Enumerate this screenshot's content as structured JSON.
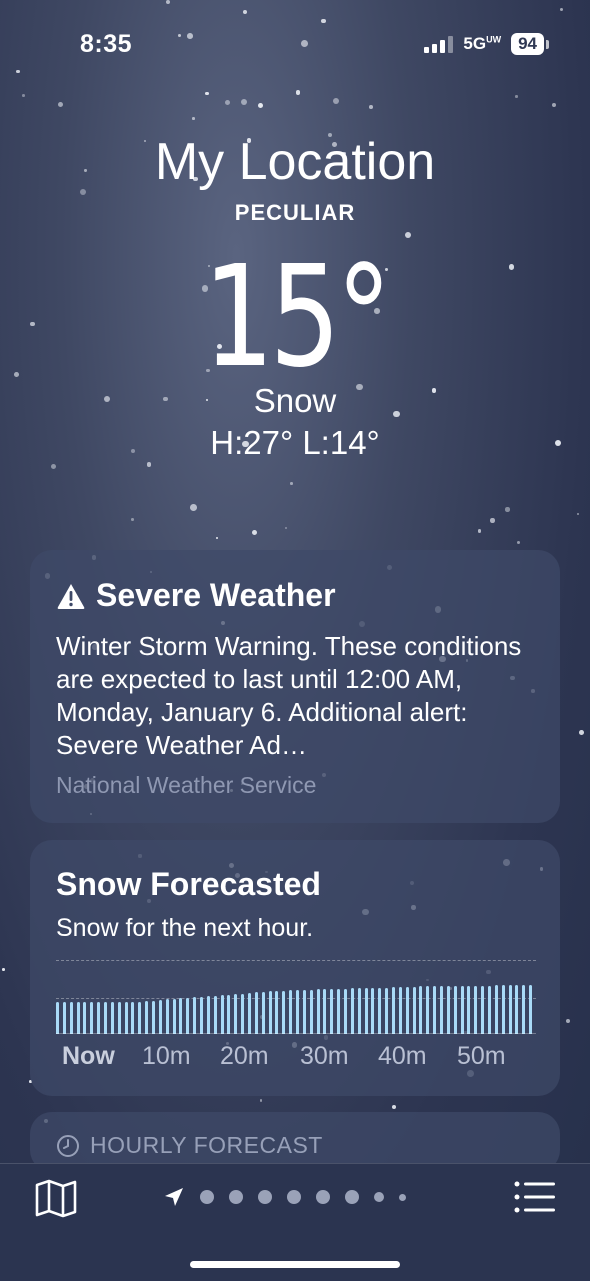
{
  "status_bar": {
    "time": "8:35",
    "network": "5G",
    "network_badge": "UW",
    "battery": "94"
  },
  "location": {
    "title": "My Location",
    "subtitle": "PECULIAR"
  },
  "current": {
    "temperature": "15°",
    "condition": "Snow",
    "high_low": "H:27°  L:14°"
  },
  "alert": {
    "title": "Severe Weather",
    "body": "Winter Storm Warning. These conditions are expected to last until 12:00 AM, Monday, January 6. Additional alert: Severe Weather Ad…",
    "source": "National Weather Service",
    "icon": "warning-triangle-icon"
  },
  "precip": {
    "title": "Snow Forecasted",
    "subtitle": "Snow for the next hour.",
    "ticks": [
      "Now",
      "10m",
      "20m",
      "30m",
      "40m",
      "50m"
    ],
    "intensity": [
      0.6,
      0.6,
      0.6,
      0.6,
      0.6,
      0.6,
      0.6,
      0.6,
      0.6,
      0.6,
      0.6,
      0.6,
      0.6,
      0.61,
      0.62,
      0.63,
      0.64,
      0.65,
      0.66,
      0.67,
      0.68,
      0.69,
      0.7,
      0.71,
      0.72,
      0.73,
      0.74,
      0.75,
      0.76,
      0.77,
      0.78,
      0.79,
      0.8,
      0.8,
      0.81,
      0.81,
      0.82,
      0.82,
      0.83,
      0.83,
      0.84,
      0.84,
      0.84,
      0.85,
      0.85,
      0.85,
      0.86,
      0.86,
      0.86,
      0.87,
      0.87,
      0.87,
      0.87,
      0.88,
      0.88,
      0.88,
      0.88,
      0.88,
      0.88,
      0.89,
      0.89,
      0.89,
      0.89,
      0.89,
      0.9,
      0.9,
      0.9,
      0.9,
      0.9,
      0.9
    ],
    "bar_color": "#a9daf7"
  },
  "hourly": {
    "label": "HOURLY FORECAST",
    "icon": "clock-icon"
  },
  "bottom_bar": {
    "map_icon": "map-icon",
    "list_icon": "list-icon",
    "location_icon": "location-arrow-icon",
    "page_count": 8
  }
}
